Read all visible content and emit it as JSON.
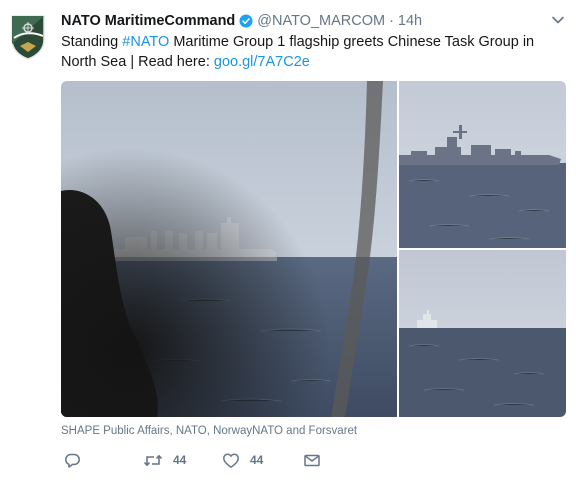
{
  "tweet": {
    "author": {
      "name": "NATO MaritimeCommand",
      "handle": "@NATO_MARCOM",
      "separator": "·",
      "time": "14h",
      "verified": true,
      "avatar_icon": "nato-marcom-crest-avatar"
    },
    "text": {
      "before": "Standing ",
      "hashtag": "#NATO",
      "after": " Maritime Group 1 flagship greets Chinese Task Group in North Sea | Read here: ",
      "link": "goo.gl/7A7C2e"
    },
    "media": {
      "images": [
        "ship-through-window-photo",
        "destroyer-photo",
        "distant-ship-photo"
      ]
    },
    "credits": "SHAPE Public Affairs, NATO, NorwayNATO and Forsvaret",
    "actions": {
      "reply_icon": "reply-icon",
      "retweet_icon": "retweet-icon",
      "retweets": "44",
      "like_icon": "heart-icon",
      "likes": "44",
      "dm_icon": "envelope-icon"
    }
  },
  "colors": {
    "link": "#1b95e0",
    "verified": "#1da1f2",
    "secondary_text": "#657786",
    "primary_text": "#14171a"
  }
}
